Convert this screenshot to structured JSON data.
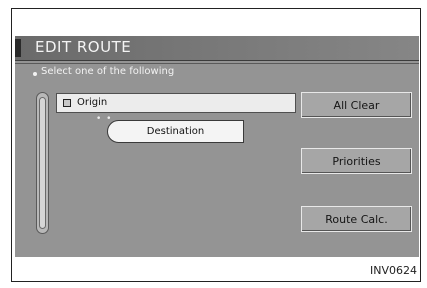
{
  "window": {
    "title": "EDIT ROUTE"
  },
  "instruction": "Select one of the following",
  "list": {
    "items": [
      {
        "label": "Origin",
        "selected": true
      },
      {
        "label": "Destination"
      }
    ]
  },
  "buttons": {
    "all_clear": "All Clear",
    "priorities": "Priorities",
    "route_calc": "Route Calc."
  },
  "caption": "INV0624",
  "icons": {
    "origin_marker": "square-bullet-icon",
    "instruction_bullet": "bullet-dot-icon"
  }
}
